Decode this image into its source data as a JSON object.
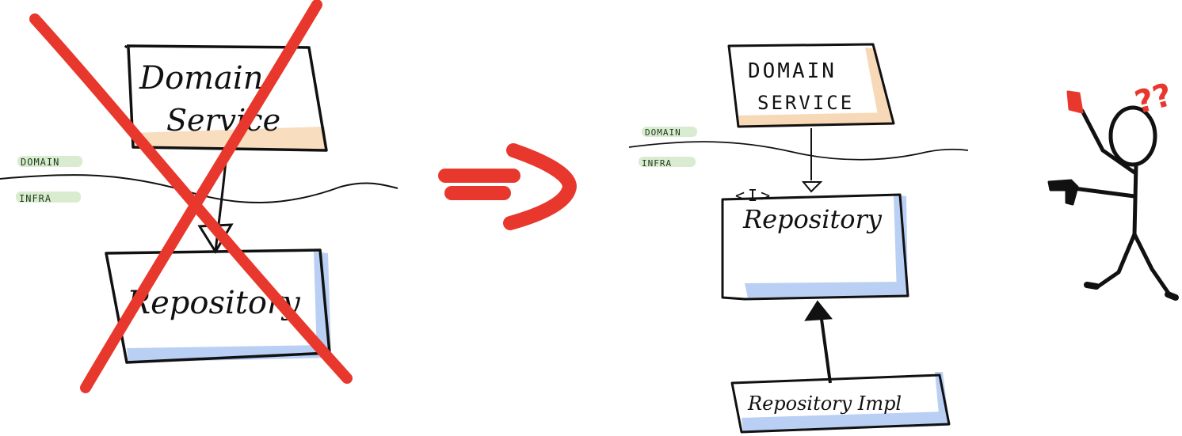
{
  "left_diagram": {
    "top_box_label_line1": "Domain",
    "top_box_label_line2": "Service",
    "bottom_box_label": "Repository",
    "layer_upper_label": "DOMAIN",
    "layer_lower_label": "INFRA"
  },
  "right_diagram": {
    "top_box_label_line1": "DOMAIN",
    "top_box_label_line2": "SERVICE",
    "interface_marker": "<I>",
    "interface_box_label": "Repository",
    "impl_box_label": "Repository Impl",
    "layer_upper_label": "DOMAIN",
    "layer_lower_label": "INFRA"
  },
  "figure": {
    "question_marks": "??",
    "question_color": "#e8382d"
  },
  "colors": {
    "cross": "#e8382d",
    "arrow": "#e8382d",
    "orange_shade": "#f7d9b8",
    "blue_shade": "#b9cff3",
    "tag_highlight": "#d9ecd0",
    "ink": "#111111"
  }
}
